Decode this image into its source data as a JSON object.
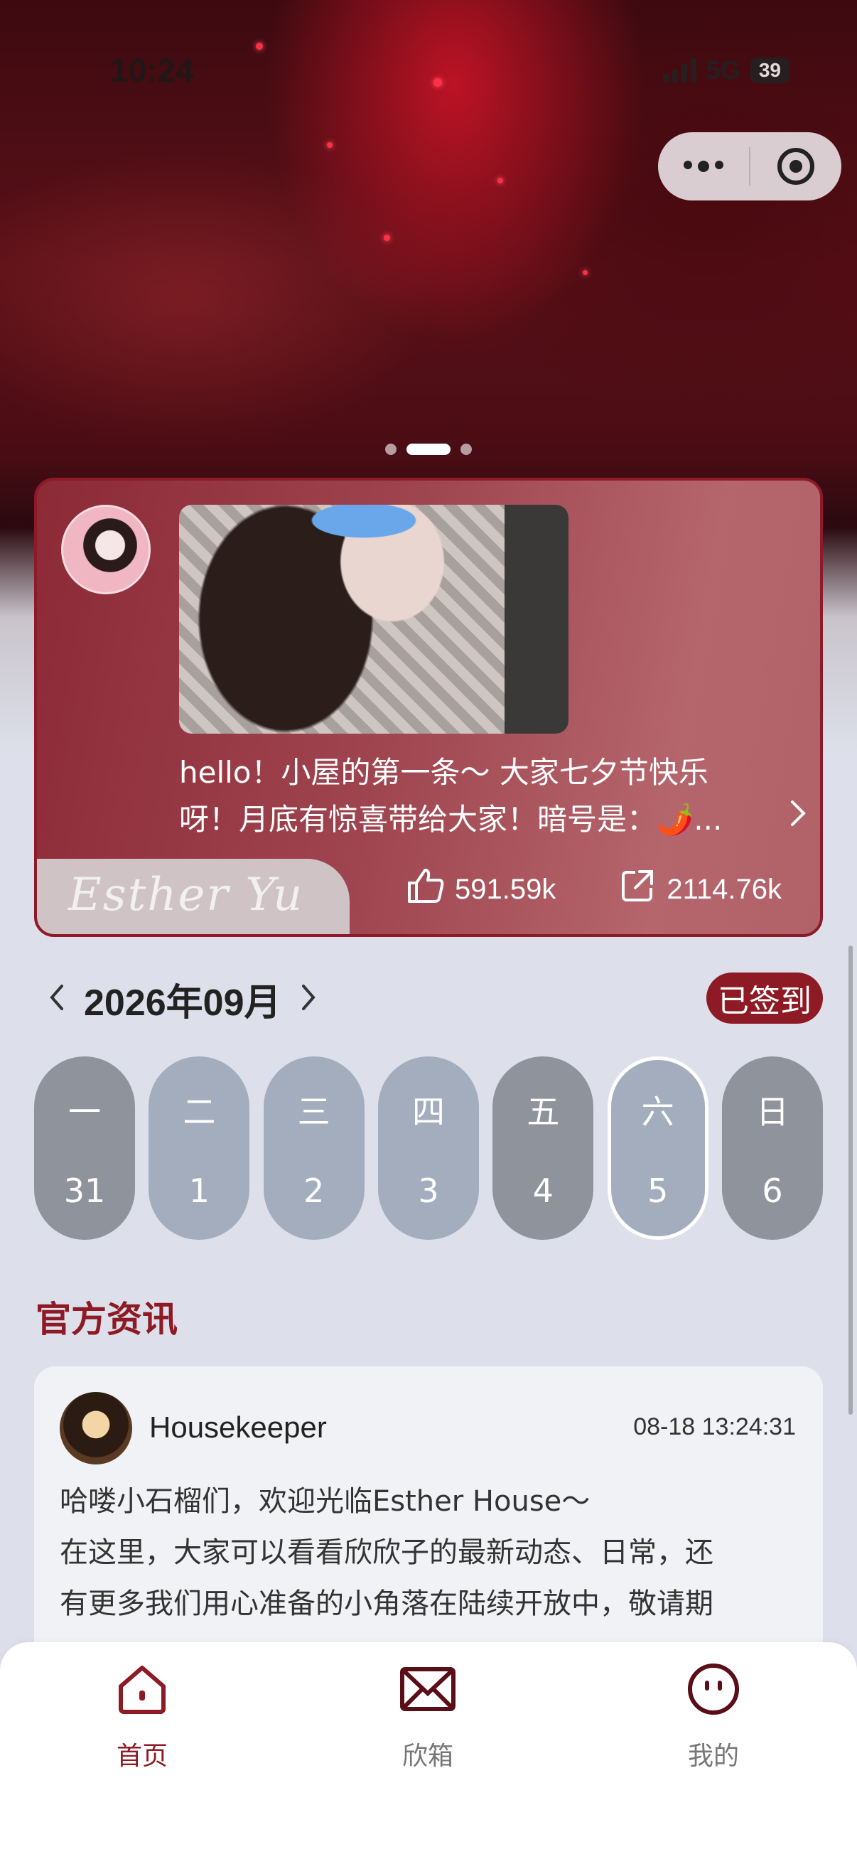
{
  "status_bar": {
    "time": "10:24",
    "network": "5G",
    "battery": "39"
  },
  "banner": {
    "slide_count": 3,
    "active_slide": 2
  },
  "post": {
    "text_line1": "hello！小屋的第一条～ 大家七夕节快乐",
    "text_line2": "呀！月底有惊喜带给大家！暗号是：🌶️...",
    "signature": "Esther Yu",
    "likes": "591.59k",
    "shares": "2114.76k"
  },
  "calendar": {
    "month_label": "2026年09月",
    "checkin_label": "已签到",
    "days": [
      {
        "weekday": "一",
        "date": "31",
        "state": "past"
      },
      {
        "weekday": "二",
        "date": "1",
        "state": "future"
      },
      {
        "weekday": "三",
        "date": "2",
        "state": "future"
      },
      {
        "weekday": "四",
        "date": "3",
        "state": "future"
      },
      {
        "weekday": "五",
        "date": "4",
        "state": "past"
      },
      {
        "weekday": "六",
        "date": "5",
        "state": "today"
      },
      {
        "weekday": "日",
        "date": "6",
        "state": "past"
      }
    ]
  },
  "news": {
    "section_title": "官方资讯",
    "author": "Housekeeper",
    "time": "08-18 13:24:31",
    "body_line1": "哈喽小石榴们，欢迎光临Esther House～",
    "body_line2": "在这里，大家可以看看欣欣子的最新动态、日常，还",
    "body_line3": "有更多我们用心准备的小角落在陆续开放中，敬请期"
  },
  "tabbar": {
    "home": "首页",
    "inbox": "欣箱",
    "me": "我的"
  },
  "colors": {
    "accent": "#8d1a24",
    "card": "#9f4550",
    "page_bg": "#dde0ea"
  }
}
